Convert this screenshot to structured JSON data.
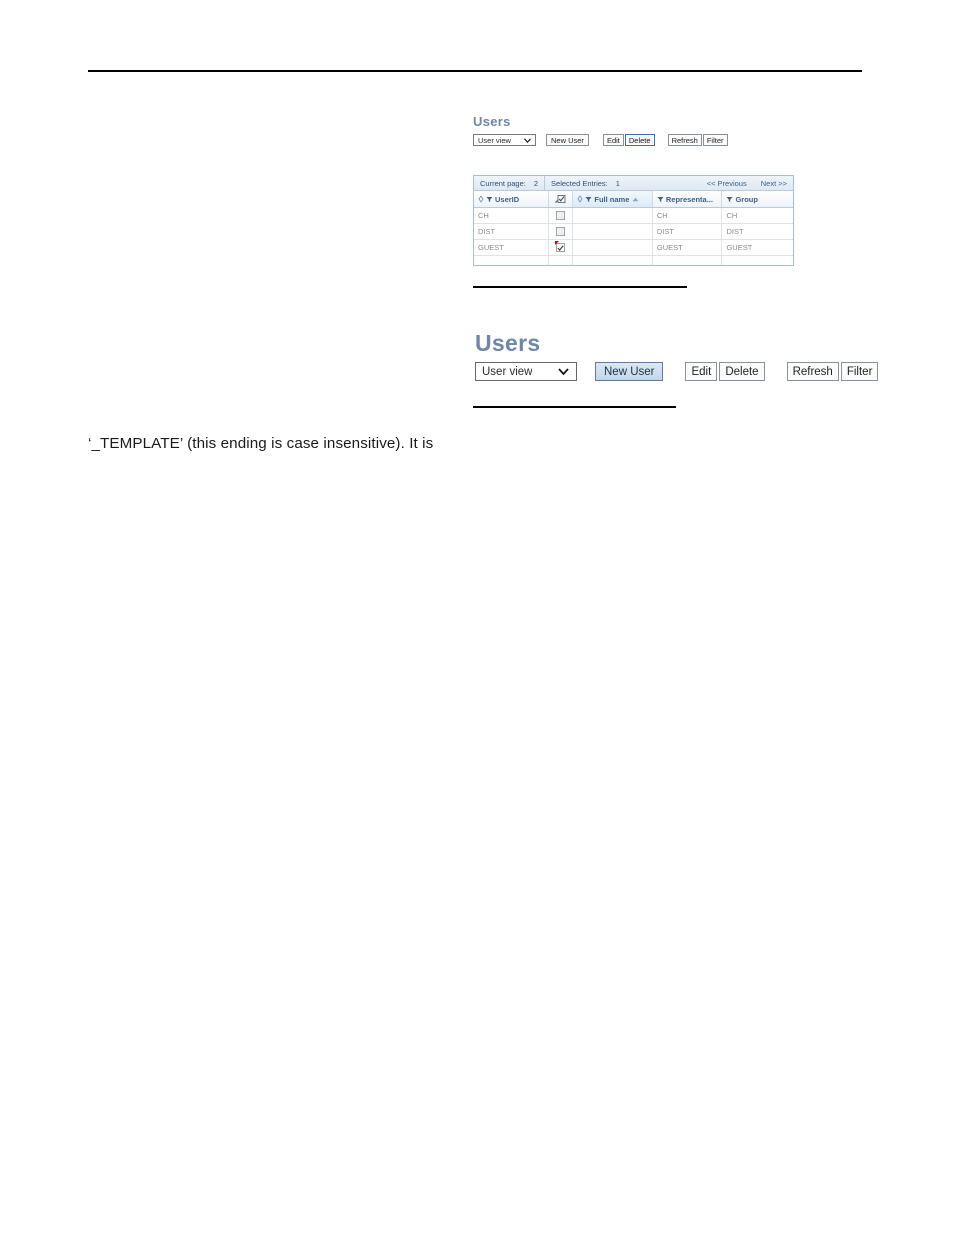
{
  "document": {
    "body_paragraph": "‘_TEMPLATE’ (this ending is case insensitive). It is"
  },
  "figure_1": {
    "title": "Users",
    "toolbar": {
      "view_select": {
        "value": "User view",
        "icon": "chevron-down-icon"
      },
      "buttons": [
        {
          "label": "New User",
          "state": "normal"
        },
        {
          "label": "Edit",
          "state": "normal"
        },
        {
          "label": "Delete",
          "state": "selected"
        },
        {
          "label": "Refresh",
          "state": "normal"
        },
        {
          "label": "Filter",
          "state": "normal"
        }
      ]
    },
    "grid": {
      "status_bar": {
        "current_page_label": "Current page:",
        "current_page_value": "2",
        "selected_entries_label": "Selected Entries:",
        "selected_entries_value": "1",
        "previous_label": "<< Previous",
        "next_label": "Next >>"
      },
      "columns": [
        {
          "label": "UserID",
          "sort_icon": "diamond-sort-icon",
          "filter_icon": "funnel-icon",
          "sorted": false
        },
        {
          "label": "",
          "header_icon": "select-all-checkbox-icon",
          "sorted": false
        },
        {
          "label": "Full name",
          "sort_icon": "diamond-sort-icon",
          "filter_icon": "funnel-icon",
          "sorted": true,
          "sort_direction": "ascending"
        },
        {
          "label": "Representa...",
          "filter_icon": "funnel-icon",
          "sorted": false
        },
        {
          "label": "Group",
          "filter_icon": "funnel-icon",
          "sorted": false
        }
      ],
      "rows": [
        {
          "userid": "CH",
          "checked": false,
          "flagged": false,
          "fullname": "",
          "representative": "CH",
          "group": "CH"
        },
        {
          "userid": "DIST",
          "checked": false,
          "flagged": false,
          "fullname": "",
          "representative": "DIST",
          "group": "DIST"
        },
        {
          "userid": "GUEST",
          "checked": true,
          "flagged": true,
          "fullname": "",
          "representative": "GUEST",
          "group": "GUEST"
        }
      ]
    }
  },
  "figure_2": {
    "title": "Users",
    "toolbar": {
      "view_select": {
        "value": "User view",
        "icon": "chevron-down-icon"
      },
      "buttons": [
        {
          "label": "New User",
          "state": "hover"
        },
        {
          "label": "Edit",
          "state": "normal"
        },
        {
          "label": "Delete",
          "state": "normal"
        },
        {
          "label": "Refresh",
          "state": "normal"
        },
        {
          "label": "Filter",
          "state": "normal"
        }
      ]
    }
  },
  "colors": {
    "title": "#6f87a6",
    "grid_border": "#a8bcd0",
    "header_text": "#3c5f86",
    "cell_text": "#8a8a8a",
    "selected_border": "#3f6fa8",
    "flag": "#d00000",
    "rule": "#000000"
  }
}
